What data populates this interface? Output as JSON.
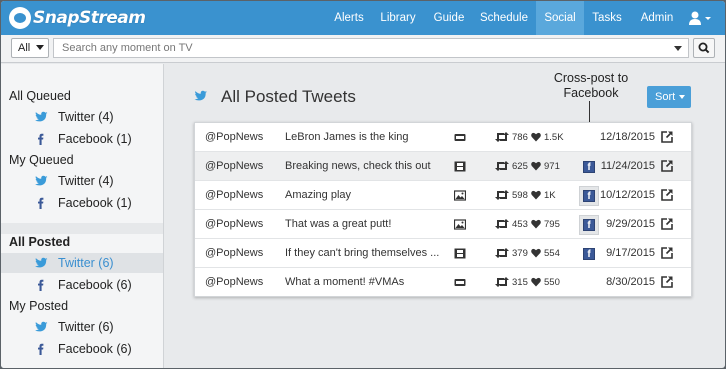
{
  "app": {
    "logo_text": "SnapStream"
  },
  "nav": {
    "items": [
      "Alerts",
      "Library",
      "Guide",
      "Schedule",
      "Social",
      "Tasks",
      "Admin"
    ],
    "active": "Social"
  },
  "search": {
    "scope": "All",
    "placeholder": "Search any moment on TV"
  },
  "sidebar": {
    "groups": [
      {
        "header": "All Queued",
        "bold": false,
        "items": [
          {
            "icon": "twitter-icon",
            "label": "Twitter (4)"
          },
          {
            "icon": "facebook-icon",
            "label": "Facebook (1)"
          }
        ]
      },
      {
        "header": "My Queued",
        "bold": false,
        "items": [
          {
            "icon": "twitter-icon",
            "label": "Twitter (4)"
          },
          {
            "icon": "facebook-icon",
            "label": "Facebook (1)"
          }
        ]
      },
      {
        "header": "All Posted",
        "bold": true,
        "items": [
          {
            "icon": "twitter-icon",
            "label": "Twitter (6)",
            "selected": true
          },
          {
            "icon": "facebook-icon",
            "label": "Facebook (6)"
          }
        ]
      },
      {
        "header": "My Posted",
        "bold": false,
        "items": [
          {
            "icon": "twitter-icon",
            "label": "Twitter (6)"
          },
          {
            "icon": "facebook-icon",
            "label": "Facebook (6)"
          }
        ]
      }
    ]
  },
  "main": {
    "title": "All Posted Tweets",
    "annotation": "Cross-post to Facebook",
    "sort_label": "Sort"
  },
  "tweets": [
    {
      "handle": "@PopNews",
      "text": "LeBron James is the king",
      "media": "gif-icon",
      "retweets": "786",
      "likes": "1.5K",
      "facebook": false,
      "date": "12/18/2015"
    },
    {
      "handle": "@PopNews",
      "text": "Breaking news, check this out",
      "media": "video-icon",
      "retweets": "625",
      "likes": "971",
      "facebook": true,
      "date": "11/24/2015"
    },
    {
      "handle": "@PopNews",
      "text": "Amazing play",
      "media": "image-icon",
      "retweets": "598",
      "likes": "1K",
      "facebook": true,
      "date": "10/12/2015"
    },
    {
      "handle": "@PopNews",
      "text": "That was a great putt!",
      "media": "image-icon",
      "retweets": "453",
      "likes": "795",
      "facebook": true,
      "date": "9/29/2015"
    },
    {
      "handle": "@PopNews",
      "text": "If they can't bring themselves ...",
      "media": "video-icon",
      "retweets": "379",
      "likes": "554",
      "facebook": true,
      "date": "9/17/2015"
    },
    {
      "handle": "@PopNews",
      "text": "What a moment! #VMAs",
      "media": "gif-icon",
      "retweets": "315",
      "likes": "550",
      "facebook": false,
      "date": "8/30/2015"
    }
  ],
  "colors": {
    "brand": "#3a92cf",
    "twitter": "#3a9bd9",
    "facebook": "#3b5998",
    "accent_button": "#4a9fd8"
  }
}
